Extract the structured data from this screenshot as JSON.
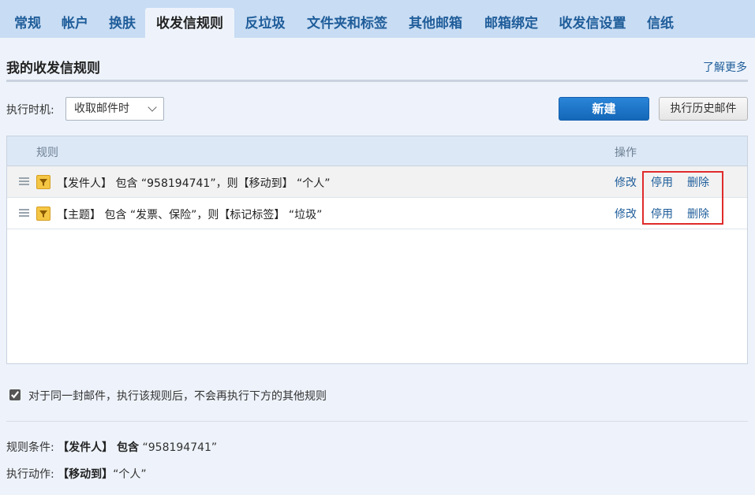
{
  "tabs": [
    {
      "label": "常规",
      "active": false
    },
    {
      "label": "帐户",
      "active": false
    },
    {
      "label": "换肤",
      "active": false
    },
    {
      "label": "收发信规则",
      "active": true
    },
    {
      "label": "反垃圾",
      "active": false
    },
    {
      "label": "文件夹和标签",
      "active": false
    },
    {
      "label": "其他邮箱",
      "active": false
    },
    {
      "label": "邮箱绑定",
      "active": false
    },
    {
      "label": "收发信设置",
      "active": false
    },
    {
      "label": "信纸",
      "active": false
    }
  ],
  "header": {
    "title": "我的收发信规则",
    "learn_more": "了解更多"
  },
  "toolbar": {
    "timing_label": "执行时机:",
    "timing_value": "收取邮件时",
    "new_button": "新建",
    "history_button": "执行历史邮件"
  },
  "table": {
    "col_rule": "规则",
    "col_ops": "操作",
    "rows": [
      {
        "text": "【发件人】 包含 “958194741”，则【移动到】 “个人”",
        "edit": "修改",
        "disable": "停用",
        "delete": "删除"
      },
      {
        "text": "【主题】 包含 “发票、保险”，则【标记标签】 “垃圾”",
        "edit": "修改",
        "disable": "停用",
        "delete": "删除"
      }
    ]
  },
  "option": {
    "checked": true,
    "label": "对于同一封邮件，执行该规则后，不会再执行下方的其他规则"
  },
  "details": {
    "condition_label": "规则条件:",
    "condition_field": "【发件人】 包含",
    "condition_value": "“958194741”",
    "action_label": "执行动作:",
    "action_field": "【移动到】",
    "action_value": "“个人”"
  },
  "colors": {
    "accent": "#1f5d9a",
    "primary_button": "#1a73c8",
    "highlight": "#e02b2b",
    "tab_bar": "#c8dcf3"
  }
}
